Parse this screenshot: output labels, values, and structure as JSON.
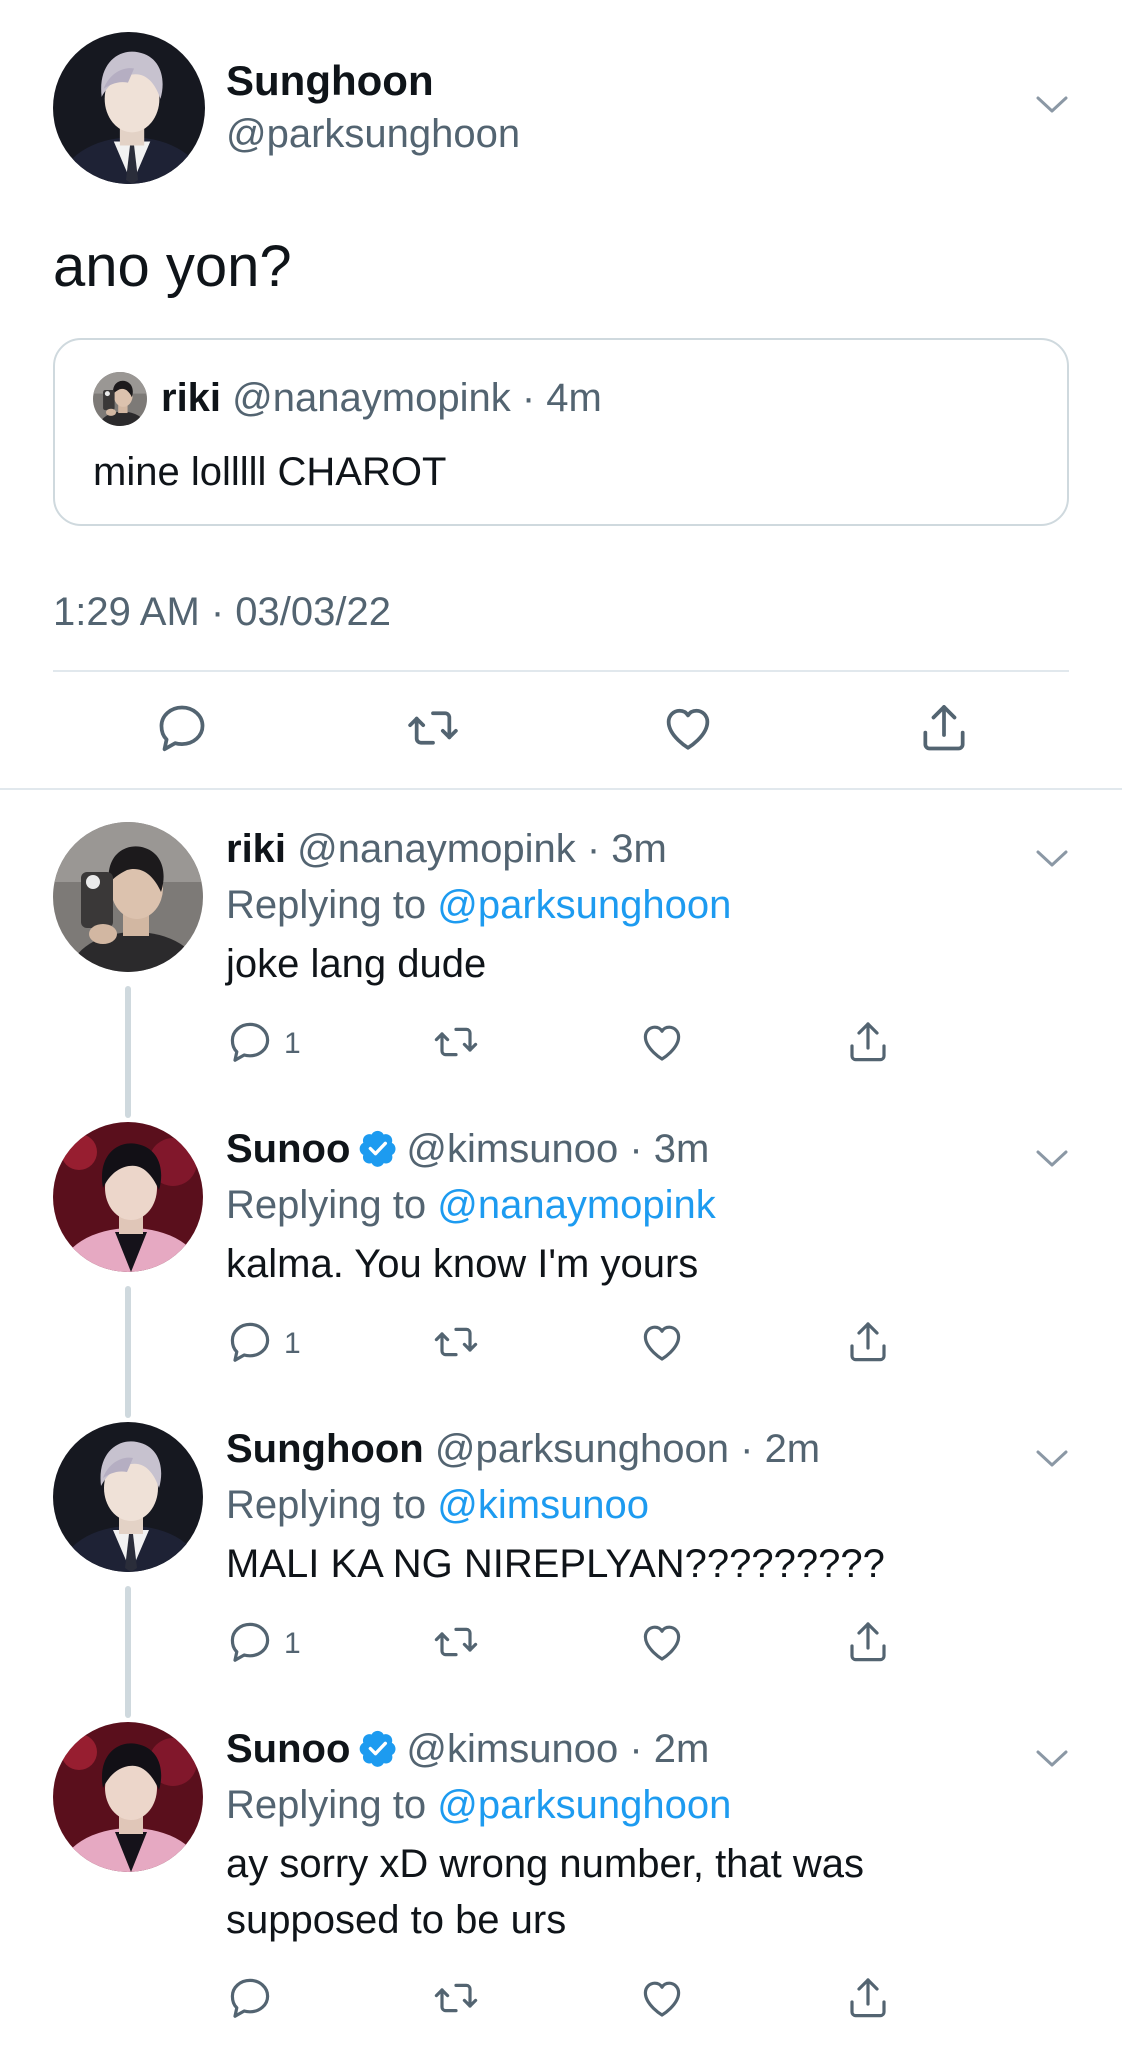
{
  "main_tweet": {
    "name": "Sunghoon",
    "handle": "@parksunghoon",
    "text": "ano yon?",
    "quote": {
      "name": "riki",
      "handle": "@nanaymopink",
      "sep": "·",
      "time": "4m",
      "text": "mine lolllll CHAROT"
    },
    "timestamp": "1:29 AM · 03/03/22"
  },
  "replies": [
    {
      "name": "riki",
      "verified": false,
      "handle": "@nanaymopink",
      "sep": "·",
      "time": "3m",
      "replying_label": "Replying to",
      "replying_to": "@parksunghoon",
      "text": "joke lang dude",
      "reply_count": "1",
      "avatar_bg": "#3a3a3a"
    },
    {
      "name": "Sunoo",
      "verified": true,
      "handle": "@kimsunoo",
      "sep": "·",
      "time": "3m",
      "replying_label": "Replying to",
      "replying_to": "@nanaymopink",
      "text": "kalma. You know I'm yours",
      "reply_count": "1",
      "avatar_bg": "#7a1a2a"
    },
    {
      "name": "Sunghoon",
      "verified": false,
      "handle": "@parksunghoon",
      "sep": "·",
      "time": "2m",
      "replying_label": "Replying to",
      "replying_to": "@kimsunoo",
      "text": "MALI KA NG NIREPLYAN?????????",
      "reply_count": "1",
      "avatar_bg": "#1a1a22"
    },
    {
      "name": "Sunoo",
      "verified": true,
      "handle": "@kimsunoo",
      "sep": "·",
      "time": "2m",
      "replying_label": "Replying to",
      "replying_to": "@parksunghoon",
      "text": "ay sorry xD wrong number, that was supposed to be urs",
      "reply_count": "",
      "avatar_bg": "#7a1a2a"
    }
  ],
  "colors": {
    "text": "#0f1419",
    "secondary": "#536471",
    "link": "#1d9bf0",
    "border": "#cfd9de"
  },
  "icons": [
    "chevron-down-icon",
    "reply-icon",
    "retweet-icon",
    "like-icon",
    "share-icon",
    "verified-badge-icon"
  ]
}
